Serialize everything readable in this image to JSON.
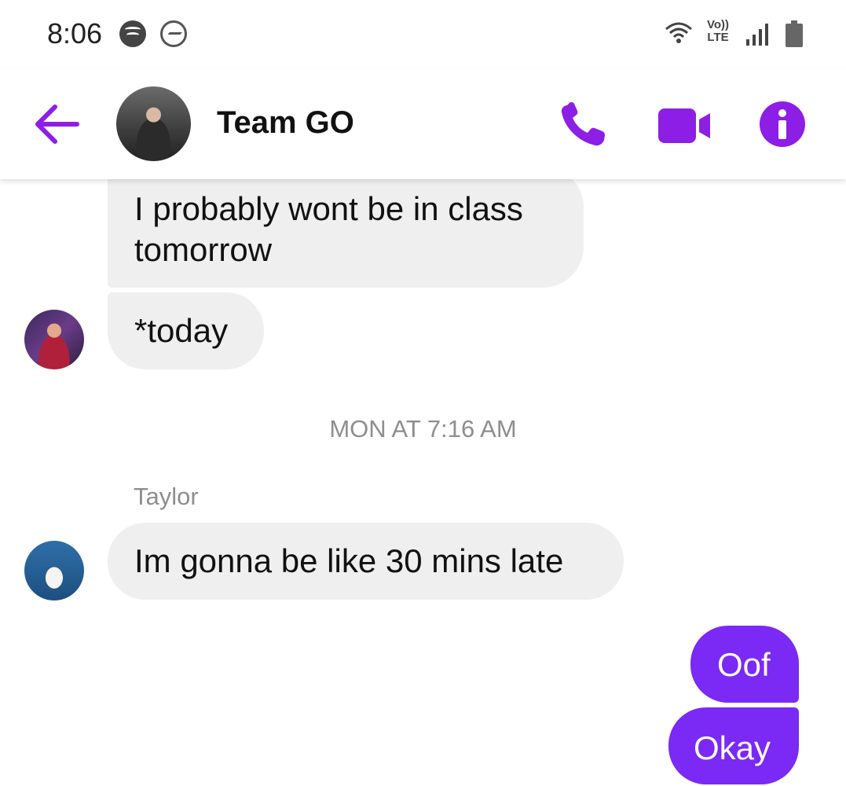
{
  "status_bar": {
    "time": "8:06",
    "volte_line1": "Vo))",
    "volte_line2": "LTE"
  },
  "header": {
    "title": "Team GO",
    "accent_color": "#8d1ee6"
  },
  "messages": [
    {
      "direction": "incoming",
      "text": "I probably wont be in class tomorrow"
    },
    {
      "direction": "incoming",
      "text": "*today"
    },
    {
      "direction": "incoming",
      "sender": "Taylor",
      "text": "Im gonna be like 30 mins late"
    },
    {
      "direction": "outgoing",
      "text": "Oof"
    },
    {
      "direction": "outgoing",
      "text": "Okay"
    }
  ],
  "timestamp": "MON AT 7:16 AM",
  "colors": {
    "incoming_bubble": "#efefef",
    "outgoing_bubble": "#7b29f5",
    "icon_accent": "#8d1ee6"
  },
  "icons": [
    "spotify-icon",
    "messenger-icon",
    "wifi-icon",
    "signal-icon",
    "battery-icon",
    "back-arrow-icon",
    "phone-icon",
    "video-camera-icon",
    "info-icon"
  ]
}
